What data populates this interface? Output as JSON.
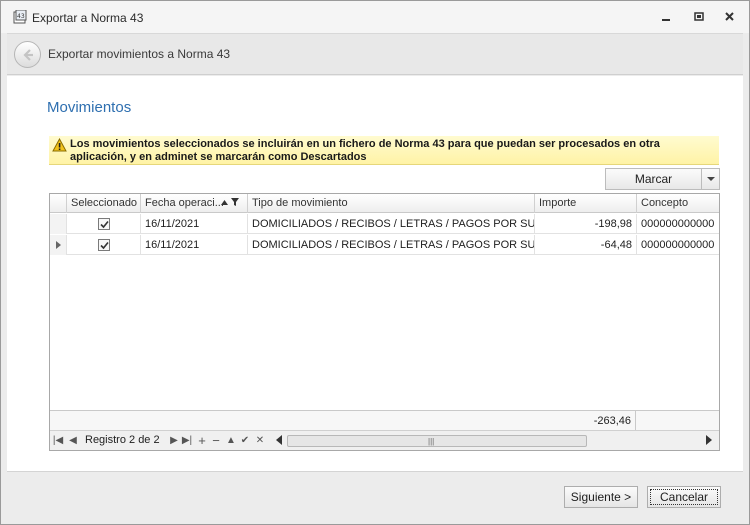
{
  "window": {
    "title": "Exportar a Norma 43"
  },
  "header": {
    "title": "Exportar movimientos a Norma 43"
  },
  "section": {
    "title": "Movimientos"
  },
  "warning": {
    "text": "Los movimientos seleccionados se incluirán en un fichero de Norma 43 para que puedan ser procesados en otra aplicación, y en adminet se marcarán como Descartados"
  },
  "toolbar": {
    "marcar_label": "Marcar"
  },
  "grid": {
    "columns": [
      "Seleccionado",
      "Fecha operaci...",
      "Tipo de movimiento",
      "Importe",
      "Concepto"
    ],
    "rows": [
      {
        "selected": true,
        "fecha": "16/11/2021",
        "tipo": "DOMICILIADOS / RECIBOS / LETRAS / PAGOS POR SU C...",
        "importe": "-198,98",
        "concepto": "000000000000"
      },
      {
        "selected": true,
        "fecha": "16/11/2021",
        "tipo": "DOMICILIADOS / RECIBOS / LETRAS / PAGOS POR SU C...",
        "importe": "-64,48",
        "concepto": "000000000000"
      }
    ],
    "footer_sum": "-263,46",
    "navigator": {
      "record_text": "Registro 2 de 2"
    }
  },
  "buttons": {
    "next_label": "Siguiente >",
    "cancel_label": "Cancelar"
  },
  "colors": {
    "accent": "#2e6fb0",
    "warning_bg": "#fff3a6"
  },
  "icons": [
    "app-icon",
    "minimize-icon",
    "maximize-icon",
    "close-icon",
    "back-arrow-icon",
    "warning-icon",
    "sort-ascending-icon",
    "filter-icon",
    "checkbox-checked-icon",
    "current-row-icon"
  ]
}
